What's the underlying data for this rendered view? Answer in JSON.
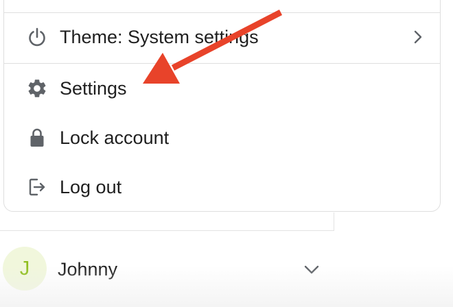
{
  "menu": {
    "items": [
      {
        "label": "Theme: System settings",
        "icon": "power-icon",
        "has_submenu": true
      },
      {
        "label": "Settings",
        "icon": "gear-icon",
        "has_submenu": false
      },
      {
        "label": "Lock account",
        "icon": "lock-icon",
        "has_submenu": false
      },
      {
        "label": "Log out",
        "icon": "logout-icon",
        "has_submenu": false
      }
    ]
  },
  "account": {
    "avatar_initial": "J",
    "name": "Johnny",
    "avatar_bg_color": "#f1f7dc",
    "avatar_text_color": "#8fbe1e"
  },
  "annotation": {
    "arrow_color": "#e8432a",
    "target": "Settings"
  },
  "colors": {
    "icon": "#5f6368",
    "text": "#1f1f1f",
    "border": "#dedede"
  }
}
